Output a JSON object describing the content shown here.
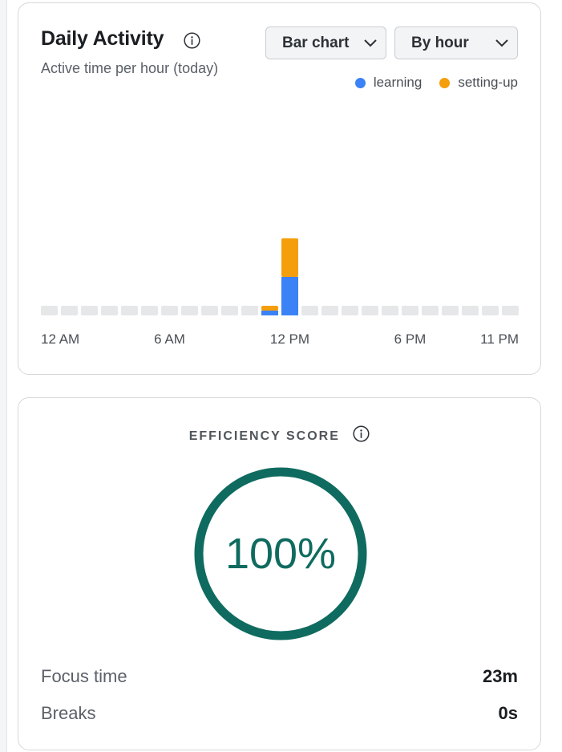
{
  "activity": {
    "title": "Daily Activity",
    "subtitle": "Active time per hour (today)",
    "chart_type_select": "Bar chart",
    "grouping_select": "By hour",
    "legend": [
      {
        "name": "learning",
        "color": "#3b82f6"
      },
      {
        "name": "setting-up",
        "color": "#f59e0b"
      }
    ]
  },
  "chart_data": {
    "type": "bar",
    "stacked": true,
    "categories": [
      "0",
      "1",
      "2",
      "3",
      "4",
      "5",
      "6",
      "7",
      "8",
      "9",
      "10",
      "11",
      "12",
      "13",
      "14",
      "15",
      "16",
      "17",
      "18",
      "19",
      "20",
      "21",
      "22",
      "23"
    ],
    "tick_labels": [
      {
        "index": 0,
        "label": "12 AM"
      },
      {
        "index": 6,
        "label": "6 AM"
      },
      {
        "index": 12,
        "label": "12 PM"
      },
      {
        "index": 18,
        "label": "6 PM"
      },
      {
        "index": 23,
        "label": "11 PM"
      }
    ],
    "series": [
      {
        "name": "learning",
        "color": "#3b82f6",
        "values": [
          0,
          0,
          0,
          0,
          0,
          0,
          0,
          0,
          0,
          0,
          0,
          1,
          8,
          0,
          0,
          0,
          0,
          0,
          0,
          0,
          0,
          0,
          0,
          0
        ]
      },
      {
        "name": "setting-up",
        "color": "#f59e0b",
        "values": [
          0,
          0,
          0,
          0,
          0,
          0,
          0,
          0,
          0,
          0,
          0,
          1,
          8,
          0,
          0,
          0,
          0,
          0,
          0,
          0,
          0,
          0,
          0,
          0
        ]
      }
    ],
    "ylim": [
      0,
      18
    ],
    "grid": false,
    "legend_position": "top-right",
    "empty_bar_color": "#e6e7e9"
  },
  "efficiency": {
    "label": "EFFICIENCY SCORE",
    "score_text": "100%",
    "score_fraction": 1.0,
    "ring_color": "#0f6b5f",
    "stats": [
      {
        "label": "Focus time",
        "value": "23m"
      },
      {
        "label": "Breaks",
        "value": "0s"
      }
    ]
  }
}
